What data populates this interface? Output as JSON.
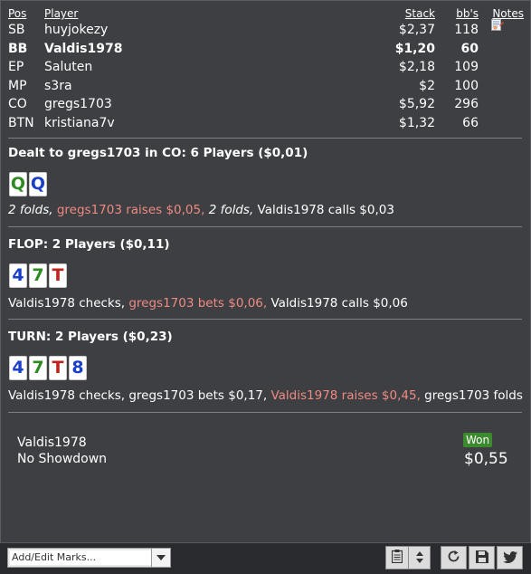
{
  "players_header": {
    "pos": "Pos",
    "player": "Player",
    "stack": "Stack",
    "bbs": "bb's",
    "notes": "Notes"
  },
  "players": [
    {
      "pos": "SB",
      "name": "huyjokezy",
      "stack": "$2,37",
      "bbs": "118",
      "bold": false,
      "has_note": true
    },
    {
      "pos": "BB",
      "name": "Valdis1978",
      "stack": "$1,20",
      "bbs": "60",
      "bold": true,
      "has_note": false
    },
    {
      "pos": "EP",
      "name": "Saluten",
      "stack": "$2,18",
      "bbs": "109",
      "bold": false,
      "has_note": false
    },
    {
      "pos": "MP",
      "name": "s3ra",
      "stack": "$2",
      "bbs": "100",
      "bold": false,
      "has_note": false
    },
    {
      "pos": "CO",
      "name": "gregs1703",
      "stack": "$5,92",
      "bbs": "296",
      "bold": false,
      "has_note": false
    },
    {
      "pos": "BTN",
      "name": "kristiana7v",
      "stack": "$1,32",
      "bbs": "66",
      "bold": false,
      "has_note": false
    }
  ],
  "preflop": {
    "title": "Dealt to gregs1703 in CO: 6 Players ($0,01)",
    "cards": [
      {
        "rank": "Q",
        "suit": "clubs"
      },
      {
        "rank": "Q",
        "suit": "diamonds"
      }
    ],
    "actions": {
      "a1": "2 folds,",
      "a2": "gregs1703 raises $0,05,",
      "a3": "2 folds,",
      "a4": "Valdis1978 calls $0,03"
    }
  },
  "flop": {
    "title": "FLOP: 2 Players ($0,11)",
    "cards": [
      {
        "rank": "4",
        "suit": "diamonds"
      },
      {
        "rank": "7",
        "suit": "clubs"
      },
      {
        "rank": "T",
        "suit": "hearts"
      }
    ],
    "actions": {
      "a1": "Valdis1978 checks,",
      "a2": "gregs1703 bets $0,06,",
      "a3": "Valdis1978 calls $0,06"
    }
  },
  "turn": {
    "title": "TURN: 2 Players ($0,23)",
    "cards": [
      {
        "rank": "4",
        "suit": "diamonds"
      },
      {
        "rank": "7",
        "suit": "clubs"
      },
      {
        "rank": "T",
        "suit": "hearts"
      },
      {
        "rank": "8",
        "suit": "diamonds"
      }
    ],
    "actions": {
      "a1": "Valdis1978 checks, gregs1703 bets $0,17,",
      "a2": "Valdis1978 raises $0,45,",
      "a3": "gregs1703 folds"
    }
  },
  "result": {
    "winner": "Valdis1978",
    "showdown": "No Showdown",
    "badge": "Won",
    "amount": "$0,55"
  },
  "toolbar": {
    "marks_placeholder": "Add/Edit Marks...",
    "icons": [
      "clipboard-icon",
      "sort-arrows-icon",
      "refresh-icon",
      "save-icon",
      "twitter-icon"
    ]
  },
  "colors": {
    "background": "#3d3f43",
    "highlight": "#f08a83",
    "won_badge": "#3b8a2e",
    "suit_clubs": "#2e8b22",
    "suit_diamonds": "#1a3fc8",
    "suit_hearts": "#c0221e"
  }
}
